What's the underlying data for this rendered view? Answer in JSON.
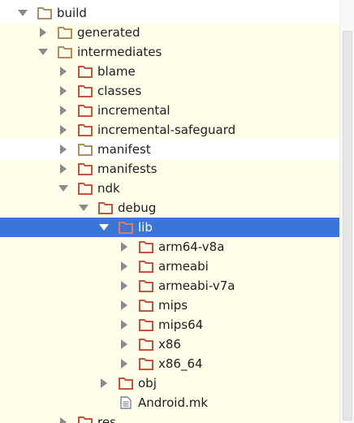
{
  "tree": {
    "rows": [
      {
        "label": "build",
        "icon": "folder-icon",
        "expanded": true,
        "highlight": "white"
      },
      {
        "label": "generated",
        "icon": "folder-icon",
        "expanded": false,
        "highlight": "yellow"
      },
      {
        "label": "intermediates",
        "icon": "folder-icon",
        "expanded": true,
        "highlight": "yellow"
      },
      {
        "label": "blame",
        "icon": "folder-excluded-icon",
        "expanded": false,
        "highlight": "yellow"
      },
      {
        "label": "classes",
        "icon": "folder-excluded-icon",
        "expanded": false,
        "highlight": "yellow"
      },
      {
        "label": "incremental",
        "icon": "folder-excluded-icon",
        "expanded": false,
        "highlight": "yellow"
      },
      {
        "label": "incremental-safeguard",
        "icon": "folder-excluded-icon",
        "expanded": false,
        "highlight": "yellow"
      },
      {
        "label": "manifest",
        "icon": "folder-icon",
        "expanded": false,
        "highlight": "white"
      },
      {
        "label": "manifests",
        "icon": "folder-excluded-icon",
        "expanded": false,
        "highlight": "yellow"
      },
      {
        "label": "ndk",
        "icon": "folder-excluded-icon",
        "expanded": true,
        "highlight": "yellow"
      },
      {
        "label": "debug",
        "icon": "folder-excluded-icon",
        "expanded": true,
        "highlight": "yellow"
      },
      {
        "label": "lib",
        "icon": "folder-excluded-icon",
        "expanded": true,
        "highlight": "selected"
      },
      {
        "label": "arm64-v8a",
        "icon": "folder-excluded-icon",
        "expanded": false,
        "highlight": "yellow"
      },
      {
        "label": "armeabi",
        "icon": "folder-excluded-icon",
        "expanded": false,
        "highlight": "yellow"
      },
      {
        "label": "armeabi-v7a",
        "icon": "folder-excluded-icon",
        "expanded": false,
        "highlight": "yellow"
      },
      {
        "label": "mips",
        "icon": "folder-excluded-icon",
        "expanded": false,
        "highlight": "yellow"
      },
      {
        "label": "mips64",
        "icon": "folder-excluded-icon",
        "expanded": false,
        "highlight": "yellow"
      },
      {
        "label": "x86",
        "icon": "folder-excluded-icon",
        "expanded": false,
        "highlight": "yellow"
      },
      {
        "label": "x86_64",
        "icon": "folder-excluded-icon",
        "expanded": false,
        "highlight": "yellow"
      },
      {
        "label": "obj",
        "icon": "folder-excluded-icon",
        "expanded": false,
        "highlight": "yellow"
      },
      {
        "label": "Android.mk",
        "icon": "file-icon",
        "expanded": null,
        "highlight": "yellow"
      },
      {
        "label": "res",
        "icon": "folder-excluded-icon",
        "expanded": false,
        "highlight": "yellow"
      }
    ]
  },
  "colors": {
    "selection": "#3a75d8",
    "excluded_row_background": "#fdfde9",
    "folder": "#b08e5a",
    "excluded_folder": "#c9543c",
    "arrow": "#8a8a8a"
  }
}
